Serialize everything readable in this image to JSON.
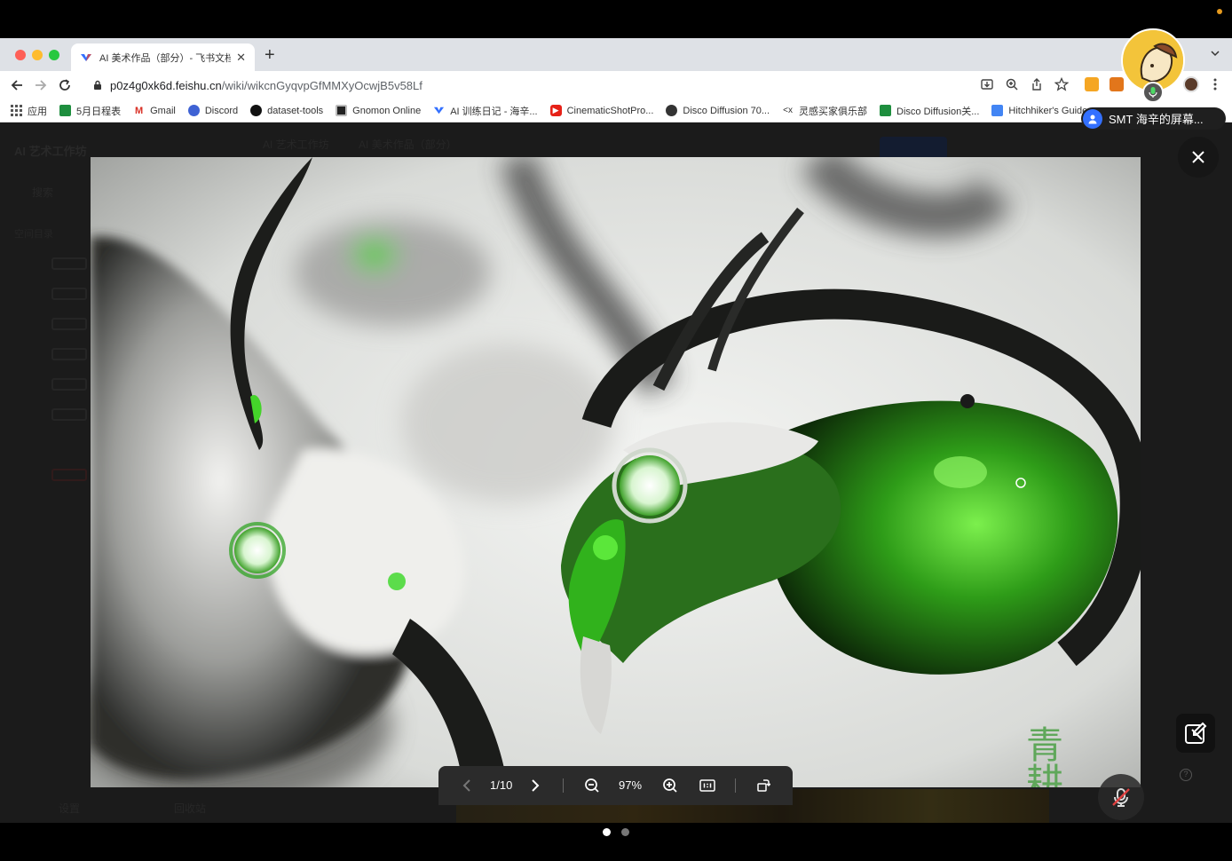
{
  "colors": {
    "accent": "#3370ff",
    "viewer_bar": "#2b2b2b",
    "glow_green": "#35c21f"
  },
  "tab": {
    "title": "AI 美术作品（部分）- 飞书文档",
    "favicon": "feishu-icon"
  },
  "address": {
    "host": "p0z4g0xk6d.feishu.cn",
    "path": "/wiki/wikcnGyqvpGfMMXyOcwjB5v58Lf"
  },
  "bookmarks": [
    {
      "label": "应用",
      "icon": "apps-grid-icon"
    },
    {
      "label": "5月日程表",
      "icon": "sheets-icon"
    },
    {
      "label": "Gmail",
      "icon": "gmail-icon"
    },
    {
      "label": "Discord",
      "icon": "discord-icon"
    },
    {
      "label": "dataset-tools",
      "icon": "github-icon"
    },
    {
      "label": "Gnomon Online",
      "icon": "gnomon-icon"
    },
    {
      "label": "AI 训练日记 - 海辛...",
      "icon": "feishu-icon"
    },
    {
      "label": "CinematicShotPro...",
      "icon": "youtube-icon"
    },
    {
      "label": "Disco Diffusion 70...",
      "icon": "globe-icon"
    },
    {
      "label": "灵感买家俱乐部",
      "icon": "link-icon"
    },
    {
      "label": "Disco Diffusion关...",
      "icon": "sheets-icon"
    },
    {
      "label": "Hitchhiker's Guide",
      "icon": "docs-icon"
    }
  ],
  "page": {
    "workspace_title": "AI 艺术工作坊",
    "search": "搜索",
    "section": "空间目录",
    "breadcrumb_1": "AI 艺术工作坊",
    "breadcrumb_2": "AI 美术作品（部分）",
    "footer_left": "设置",
    "footer_right": "回收站"
  },
  "viewer": {
    "page_indicator": "1/10",
    "zoom": "97%",
    "signature": "青耕"
  },
  "presenter": {
    "sharing_label": "SMT 海辛的屏幕..."
  },
  "pagination": {
    "total": 2,
    "active": 0
  }
}
